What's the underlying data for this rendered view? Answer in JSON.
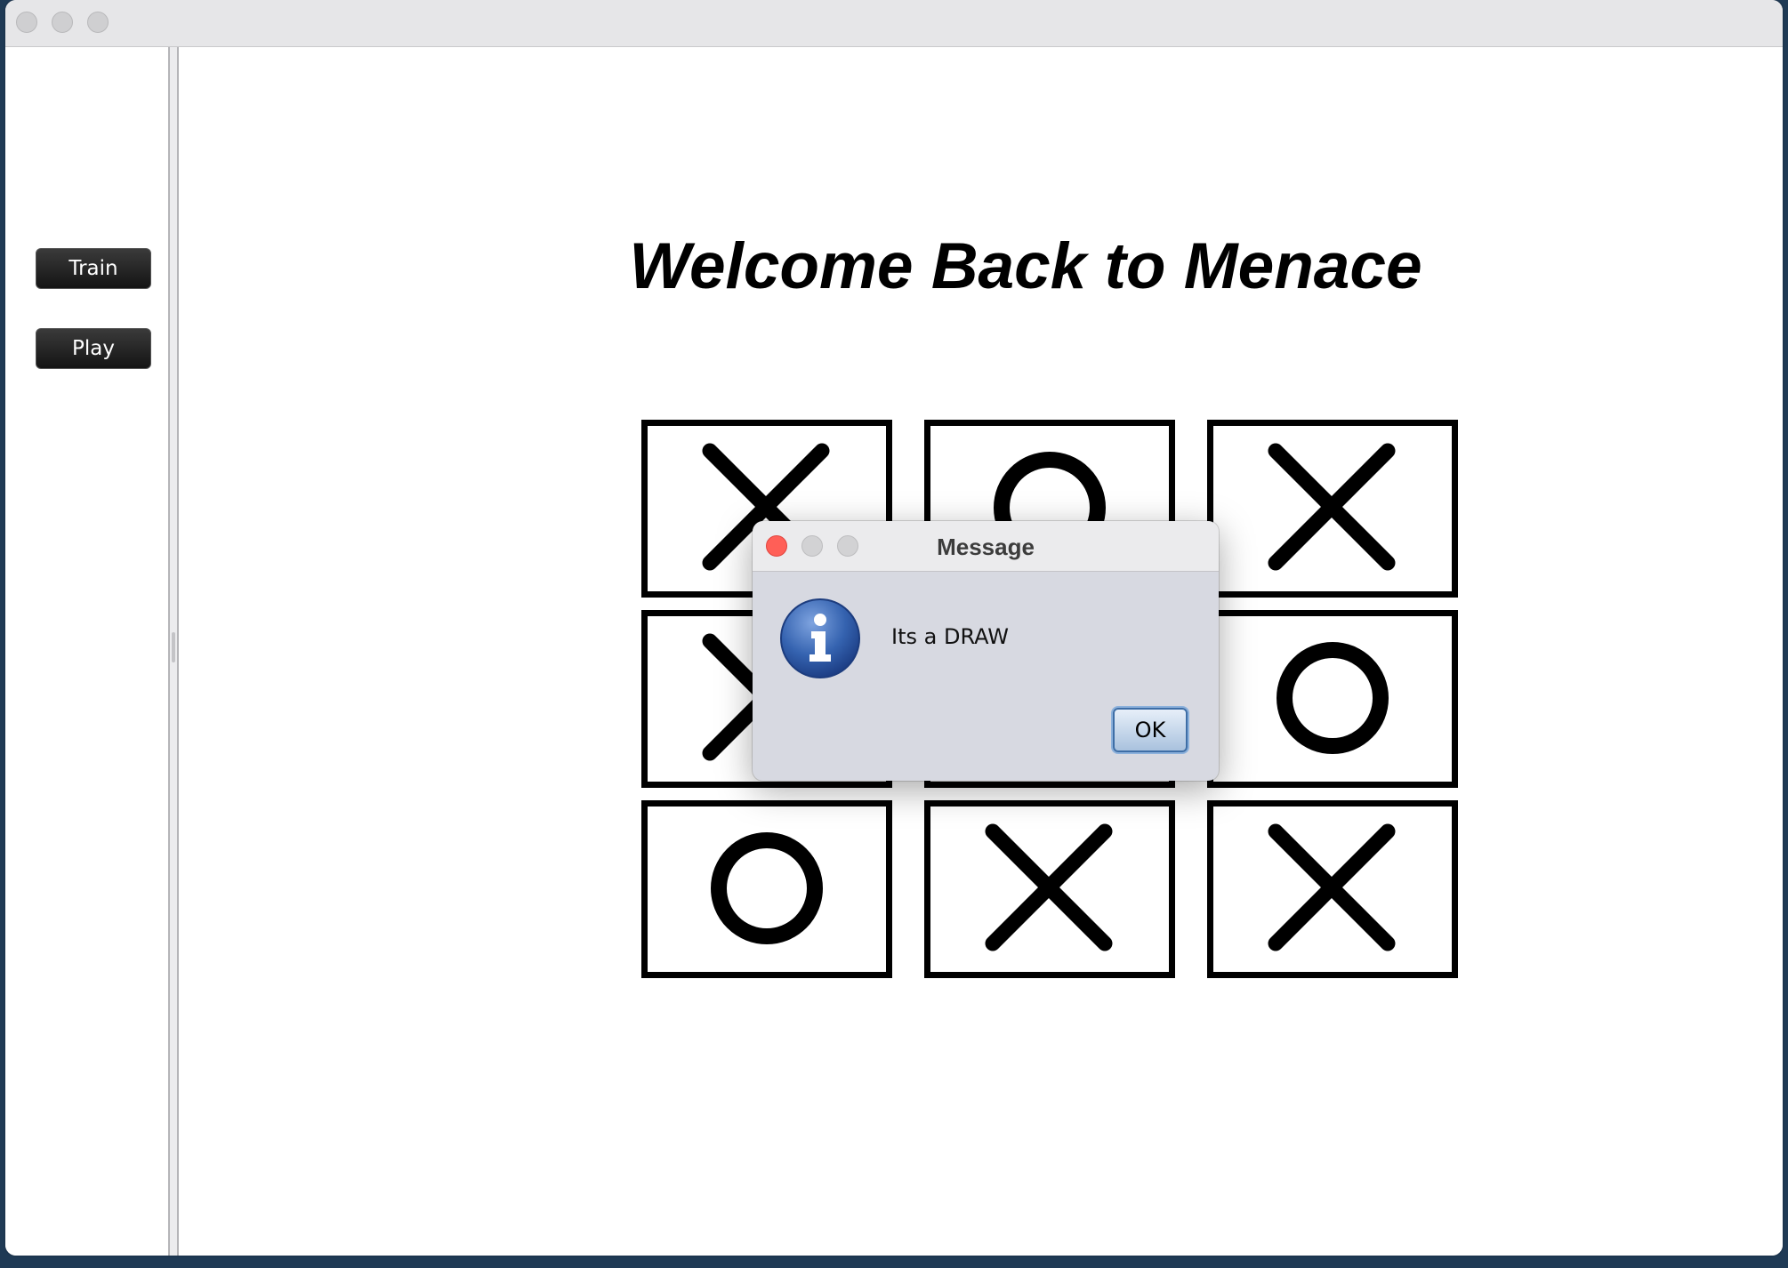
{
  "window": {
    "controls": [
      "close",
      "minimize",
      "zoom"
    ]
  },
  "sidebar": {
    "train_label": "Train",
    "play_label": "Play"
  },
  "main": {
    "title": "Welcome Back to Menace"
  },
  "board": {
    "cells": [
      "X",
      "O",
      "X",
      "X",
      "",
      "O",
      "O",
      "X",
      "X"
    ]
  },
  "dialog": {
    "title": "Message",
    "message": "Its a DRAW",
    "ok_label": "OK",
    "icon": "info-icon"
  },
  "colors": {
    "close_red": "#ff5f57",
    "button_dark": "#1e1e1e",
    "ok_blue": "#3e6ea6",
    "info_blue": "#2f5ca8"
  }
}
